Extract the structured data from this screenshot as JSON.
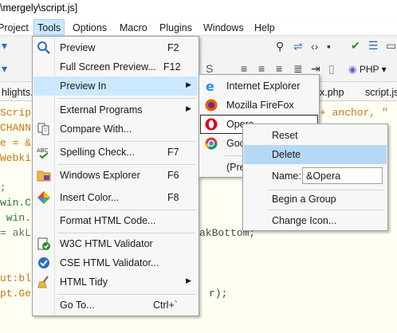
{
  "window": {
    "title": "\\mergely\\script.js]"
  },
  "menubar": {
    "items": [
      {
        "label": "Project"
      },
      {
        "label": "Tools"
      },
      {
        "label": "Options"
      },
      {
        "label": "Macro"
      },
      {
        "label": "Plugins"
      },
      {
        "label": "Windows"
      },
      {
        "label": "Help"
      }
    ]
  },
  "toolbar": {
    "php_label": "PHP"
  },
  "tabs": {
    "left": "hlights.",
    "middle": "x.php",
    "right": "script.js"
  },
  "editor": {
    "lines": [
      "Scrip",
      "CHANN",
      "e = &",
      "Webki",
      ";",
      "win.C",
      " win.",
      "= akL",
      "",
      "",
      "ut:bl",
      "pt.Ge"
    ],
    "right_fragments": {
      "line0": "+ anchor, \"",
      "line7": "akBottom;",
      "line11": "r);"
    }
  },
  "tools_menu": {
    "items": [
      {
        "label": "Preview",
        "shortcut": "F2",
        "icon": "preview-icon"
      },
      {
        "label": "Full Screen Preview...",
        "shortcut": "F12"
      },
      {
        "label": "Preview In",
        "has_submenu": true
      },
      {
        "label": "External Programs",
        "has_submenu": true
      },
      {
        "label": "Compare With...",
        "icon": "compare-icon"
      },
      {
        "label": "Spelling Check...",
        "shortcut": "F7",
        "icon": "spelling-icon"
      },
      {
        "label": "Windows Explorer",
        "shortcut": "F6",
        "icon": "folder-icon"
      },
      {
        "label": "Insert Color...",
        "shortcut": "F8",
        "icon": "color-icon"
      },
      {
        "label": "Format HTML Code..."
      },
      {
        "label": "W3C HTML Validator",
        "icon": "w3c-validator-icon"
      },
      {
        "label": "CSE HTML Validator...",
        "icon": "cse-validator-icon"
      },
      {
        "label": "HTML Tidy",
        "has_submenu": true,
        "icon": "broom-icon"
      },
      {
        "label": "Go To...",
        "shortcut": "Ctrl+`"
      }
    ]
  },
  "preview_in_menu": {
    "items": [
      {
        "label": "Internet Explorer",
        "icon": "internet-explorer-icon"
      },
      {
        "label": "Mozilla FireFox",
        "icon": "firefox-icon"
      },
      {
        "label": "Opera",
        "icon": "opera-icon"
      },
      {
        "label": "Goo",
        "icon": "chrome-icon"
      },
      {
        "label": "(Pre"
      }
    ]
  },
  "context_menu": {
    "reset": "Reset",
    "delete": "Delete",
    "name_label": "Name:",
    "name_value": "&Opera",
    "begin_group": "Begin a Group",
    "change_icon": "Change Icon..."
  }
}
